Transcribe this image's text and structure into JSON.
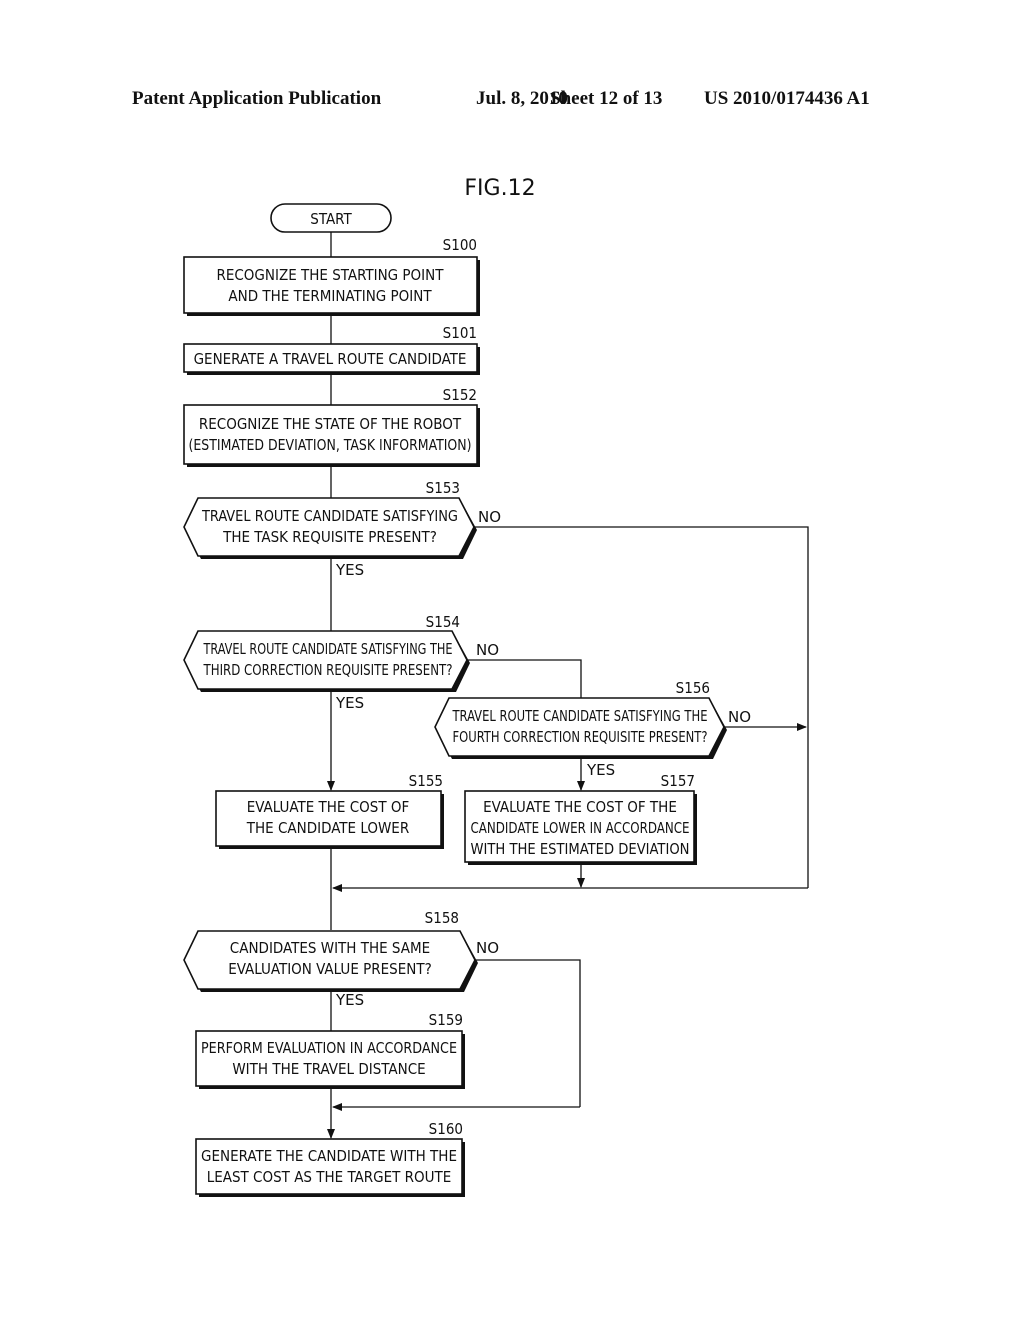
{
  "header": {
    "publication": "Patent Application Publication",
    "date": "Jul. 8, 2010",
    "sheet": "Sheet 12 of 13",
    "number": "US 2010/0174436 A1"
  },
  "figure": {
    "title": "FIG.12",
    "start": "START",
    "steps": {
      "s100": {
        "id": "S100",
        "lines": [
          "RECOGNIZE THE STARTING POINT",
          "AND THE TERMINATING POINT"
        ]
      },
      "s101": {
        "id": "S101",
        "lines": [
          "GENERATE A TRAVEL ROUTE CANDIDATE"
        ]
      },
      "s152": {
        "id": "S152",
        "lines": [
          "RECOGNIZE THE STATE OF THE ROBOT",
          "(ESTIMATED DEVIATION, TASK INFORMATION)"
        ]
      },
      "s153": {
        "id": "S153",
        "lines": [
          "TRAVEL ROUTE CANDIDATE SATISFYING",
          "THE TASK REQUISITE PRESENT?"
        ],
        "yes": "YES",
        "no": "NO"
      },
      "s154": {
        "id": "S154",
        "lines": [
          "TRAVEL ROUTE CANDIDATE SATISFYING THE",
          "THIRD CORRECTION REQUISITE PRESENT?"
        ],
        "yes": "YES",
        "no": "NO"
      },
      "s156": {
        "id": "S156",
        "lines": [
          "TRAVEL ROUTE CANDIDATE SATISFYING THE",
          "FOURTH CORRECTION REQUISITE PRESENT?"
        ],
        "yes": "YES",
        "no": "NO"
      },
      "s155": {
        "id": "S155",
        "lines": [
          "EVALUATE THE COST OF",
          "THE CANDIDATE LOWER"
        ]
      },
      "s157": {
        "id": "S157",
        "lines": [
          "EVALUATE THE COST OF THE",
          "CANDIDATE LOWER IN ACCORDANCE",
          "WITH THE ESTIMATED DEVIATION"
        ]
      },
      "s158": {
        "id": "S158",
        "lines": [
          "CANDIDATES WITH THE SAME",
          "EVALUATION VALUE PRESENT?"
        ],
        "yes": "YES",
        "no": "NO"
      },
      "s159": {
        "id": "S159",
        "lines": [
          "PERFORM EVALUATION IN ACCORDANCE",
          "WITH THE TRAVEL DISTANCE"
        ]
      },
      "s160": {
        "id": "S160",
        "lines": [
          "GENERATE THE CANDIDATE WITH THE",
          "LEAST COST AS THE TARGET ROUTE"
        ]
      }
    }
  }
}
